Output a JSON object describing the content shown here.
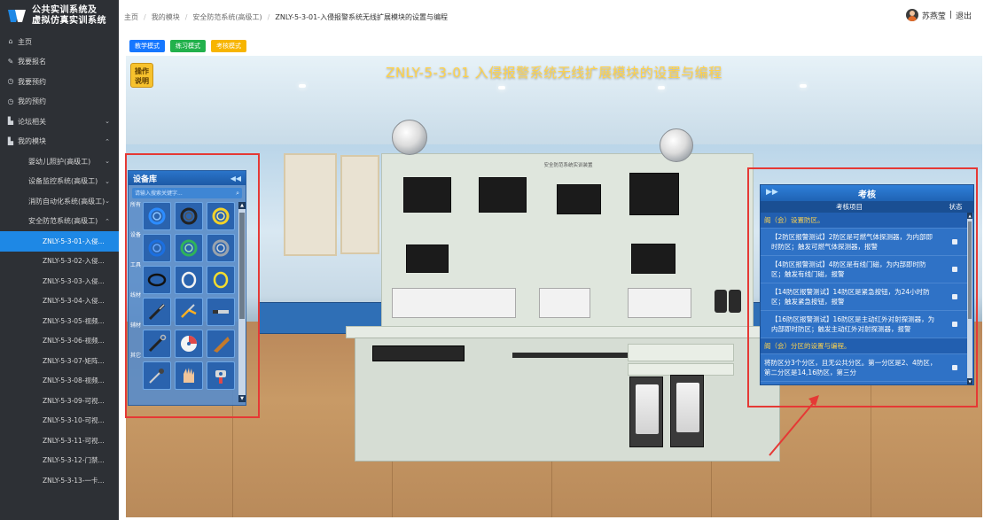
{
  "brand": {
    "line1": "公共实训系统及",
    "line2": "虚拟仿真实训系统"
  },
  "sidebar": {
    "items": [
      {
        "label": "主页",
        "icon": "home-icon"
      },
      {
        "label": "我要报名",
        "icon": "signup-icon"
      },
      {
        "label": "我要预约",
        "icon": "clock-icon"
      },
      {
        "label": "我的预约",
        "icon": "clock-icon"
      },
      {
        "label": "论坛相关",
        "icon": "chart-icon"
      },
      {
        "label": "我的模块",
        "icon": "chart-icon"
      },
      {
        "label": "婴幼儿照护(高级工)"
      },
      {
        "label": "设备监控系统(高级工)"
      },
      {
        "label": "消防自动化系统(高级工)"
      },
      {
        "label": "安全防范系统(高级工)"
      },
      {
        "label": "ZNLY-5-3-01-入侵..."
      },
      {
        "label": "ZNLY-5-3-02-入侵..."
      },
      {
        "label": "ZNLY-5-3-03-入侵..."
      },
      {
        "label": "ZNLY-5-3-04-入侵..."
      },
      {
        "label": "ZNLY-5-3-05-视频..."
      },
      {
        "label": "ZNLY-5-3-06-视频..."
      },
      {
        "label": "ZNLY-5-3-07-矩阵..."
      },
      {
        "label": "ZNLY-5-3-08-视频..."
      },
      {
        "label": "ZNLY-5-3-09-可视..."
      },
      {
        "label": "ZNLY-5-3-10-可视..."
      },
      {
        "label": "ZNLY-5-3-11-可视..."
      },
      {
        "label": "ZNLY-5-3-12-门禁..."
      },
      {
        "label": "ZNLY-5-3-13-一卡..."
      }
    ]
  },
  "breadcrumb": {
    "home": "主页",
    "module": "我的模块",
    "category": "安全防范系统(高级工)",
    "current": "ZNLY-5-3-01-入侵报警系统无线扩展模块的设置与编程"
  },
  "user": {
    "name": "苏燕莹",
    "logout": "退出"
  },
  "modes": {
    "teach": "教学模式",
    "practice": "练习模式",
    "exam": "考核模式"
  },
  "scene": {
    "title": "ZNLY-5-3-01 入侵报警系统无线扩展模块的设置与编程",
    "op_line1": "操作",
    "op_line2": "说明",
    "bench_label": "安全防范系统实训装置"
  },
  "library": {
    "title": "设备库",
    "collapse": "◀◀",
    "search_placeholder": "请输入搜索关键字...",
    "categories": [
      "所有",
      "设备",
      "工具",
      "线材",
      "辅材",
      "其它"
    ],
    "items": [
      "coil-blue-icon",
      "coil-black-icon",
      "coil-yellow-icon",
      "coil-blue-icon",
      "coil-green-icon",
      "coil-grey-icon",
      "cable-black-icon",
      "cable-white-icon",
      "cable-yellow-icon",
      "screwdriver-icon",
      "pliers-icon",
      "stripper-icon",
      "wrench-icon",
      "disc-icon",
      "tape-icon",
      "probe-icon",
      "glove-icon",
      "drill-icon"
    ]
  },
  "exam": {
    "expand": "▶▶",
    "title": "考核",
    "col_item": "考核项目",
    "col_status": "状态",
    "section1": "阁（会）设置防区。",
    "rows": [
      "【2防区报警测试】2防区是可燃气体探测器，为内部即时防区；触发可燃气体探测器，报警",
      "【4防区报警测试】4防区是有线门磁，为内部即时防区；触发有线门磁，报警",
      "【14防区报警测试】14防区是紧急按钮，为24小时防区；触发紧急按钮，报警",
      "【16防区报警测试】16防区是主动红外对射探测器，为内部即时防区；触发主动红外对射探测器，报警"
    ],
    "section2": "阁（会）分区的设置与编程。",
    "tail": "将防区分3个分区，且无公共分区。第一分区是2、4防区，第二分区是14,16防区，第三分"
  },
  "colors": {
    "sidebar_bg": "#2d3035",
    "active": "#1e88e5",
    "teach": "#1677ff",
    "practice": "#22b14c",
    "exam": "#f7b500",
    "highlight": "#e53935",
    "title_yellow": "#ffd24a"
  }
}
